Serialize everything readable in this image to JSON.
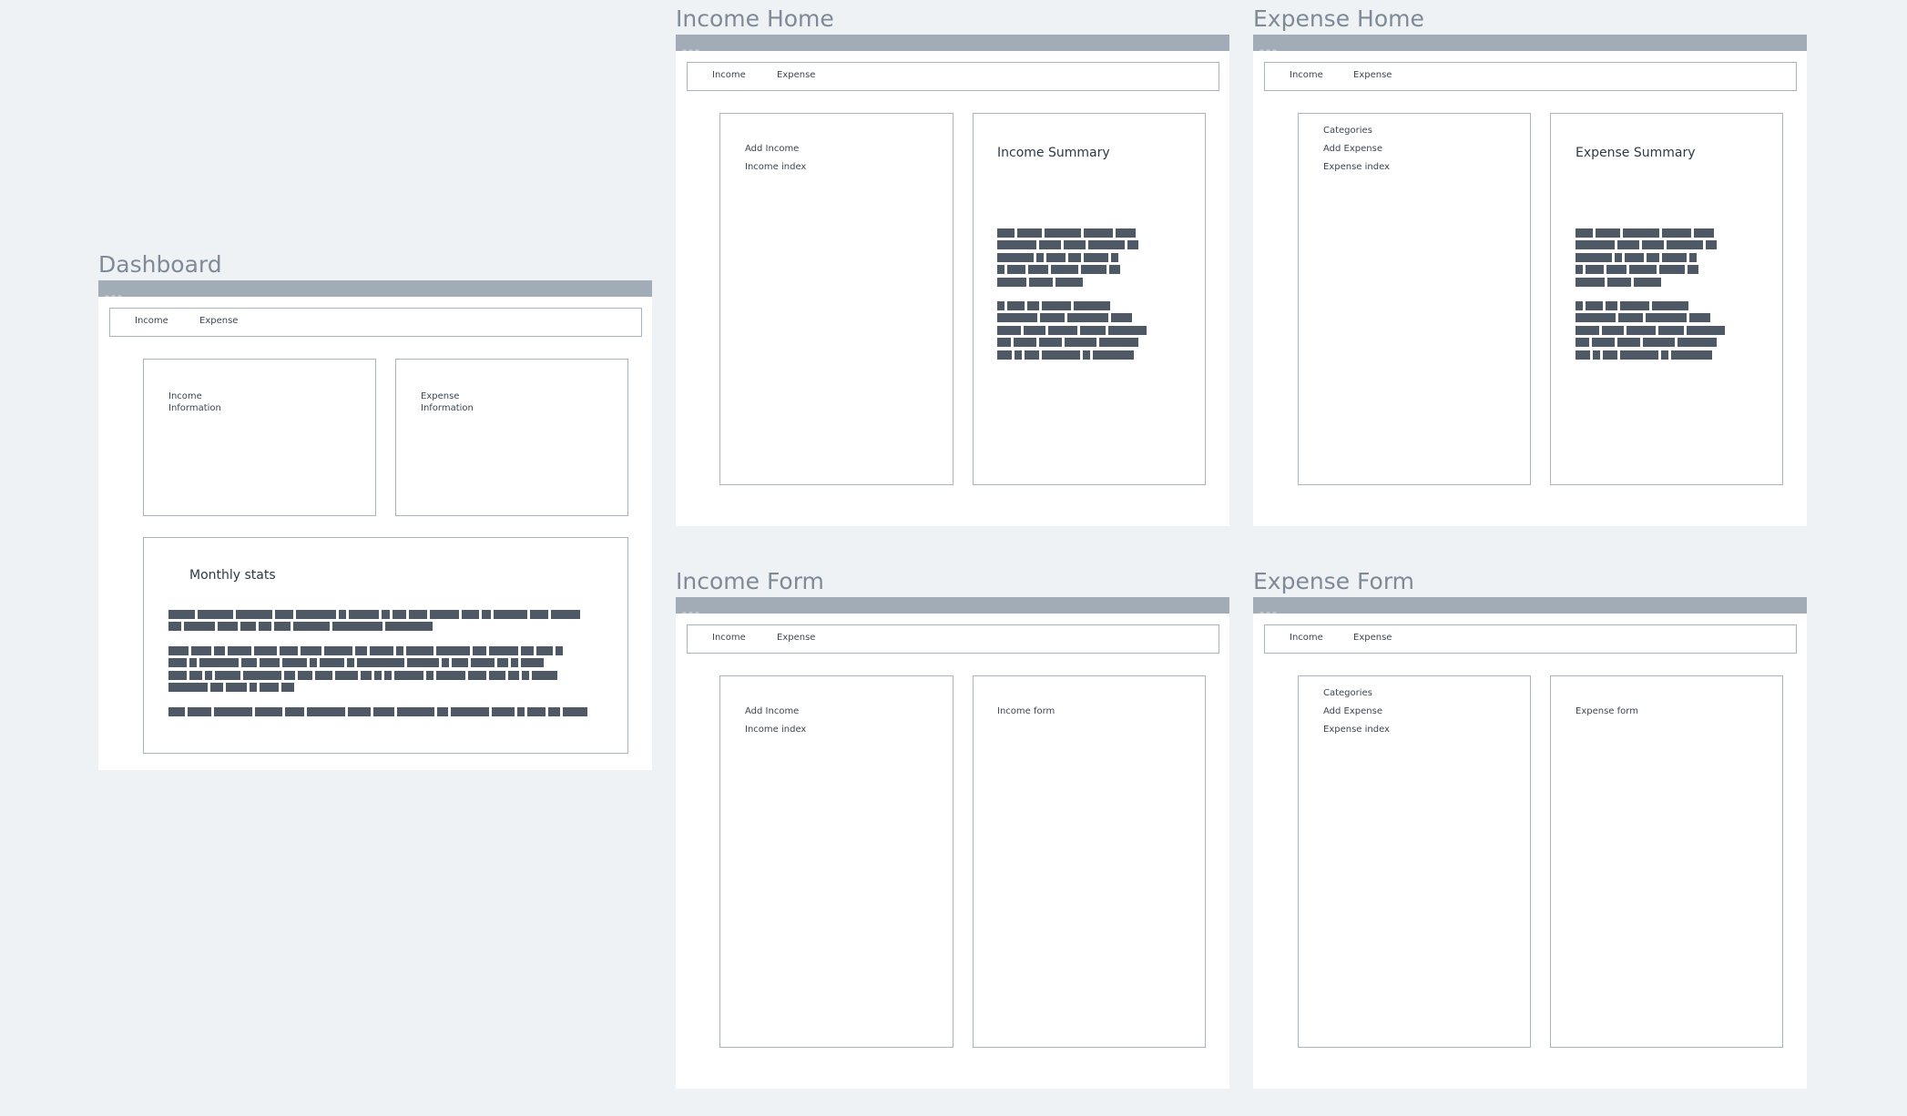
{
  "nav": {
    "income": "Income",
    "expense": "Expense"
  },
  "dashboard": {
    "title": "Dashboard",
    "income_info_line1": "Income",
    "income_info_line2": "Information",
    "expense_info_line1": "Expense",
    "expense_info_line2": "Information",
    "monthly_stats": "Monthly stats"
  },
  "income_home": {
    "title": "Income Home",
    "menu": [
      "Add Income",
      "Income index"
    ],
    "summary_heading": "Income Summary"
  },
  "expense_home": {
    "title": "Expense Home",
    "menu": [
      "Categories",
      "Add Expense",
      "Expense index"
    ],
    "summary_heading": "Expense Summary"
  },
  "income_form": {
    "title": "Income Form",
    "menu": [
      "Add Income",
      "Income index"
    ],
    "form_label": "Income form"
  },
  "expense_form": {
    "title": "Expense Form",
    "menu": [
      "Categories",
      "Add Expense",
      "Expense index"
    ],
    "form_label": "Expense form"
  },
  "colors": {
    "canvas": "#eff2f5",
    "titlebar": "#a2acb7",
    "frame_title": "#7e8a98",
    "placeholder_text": "#4e5965"
  }
}
